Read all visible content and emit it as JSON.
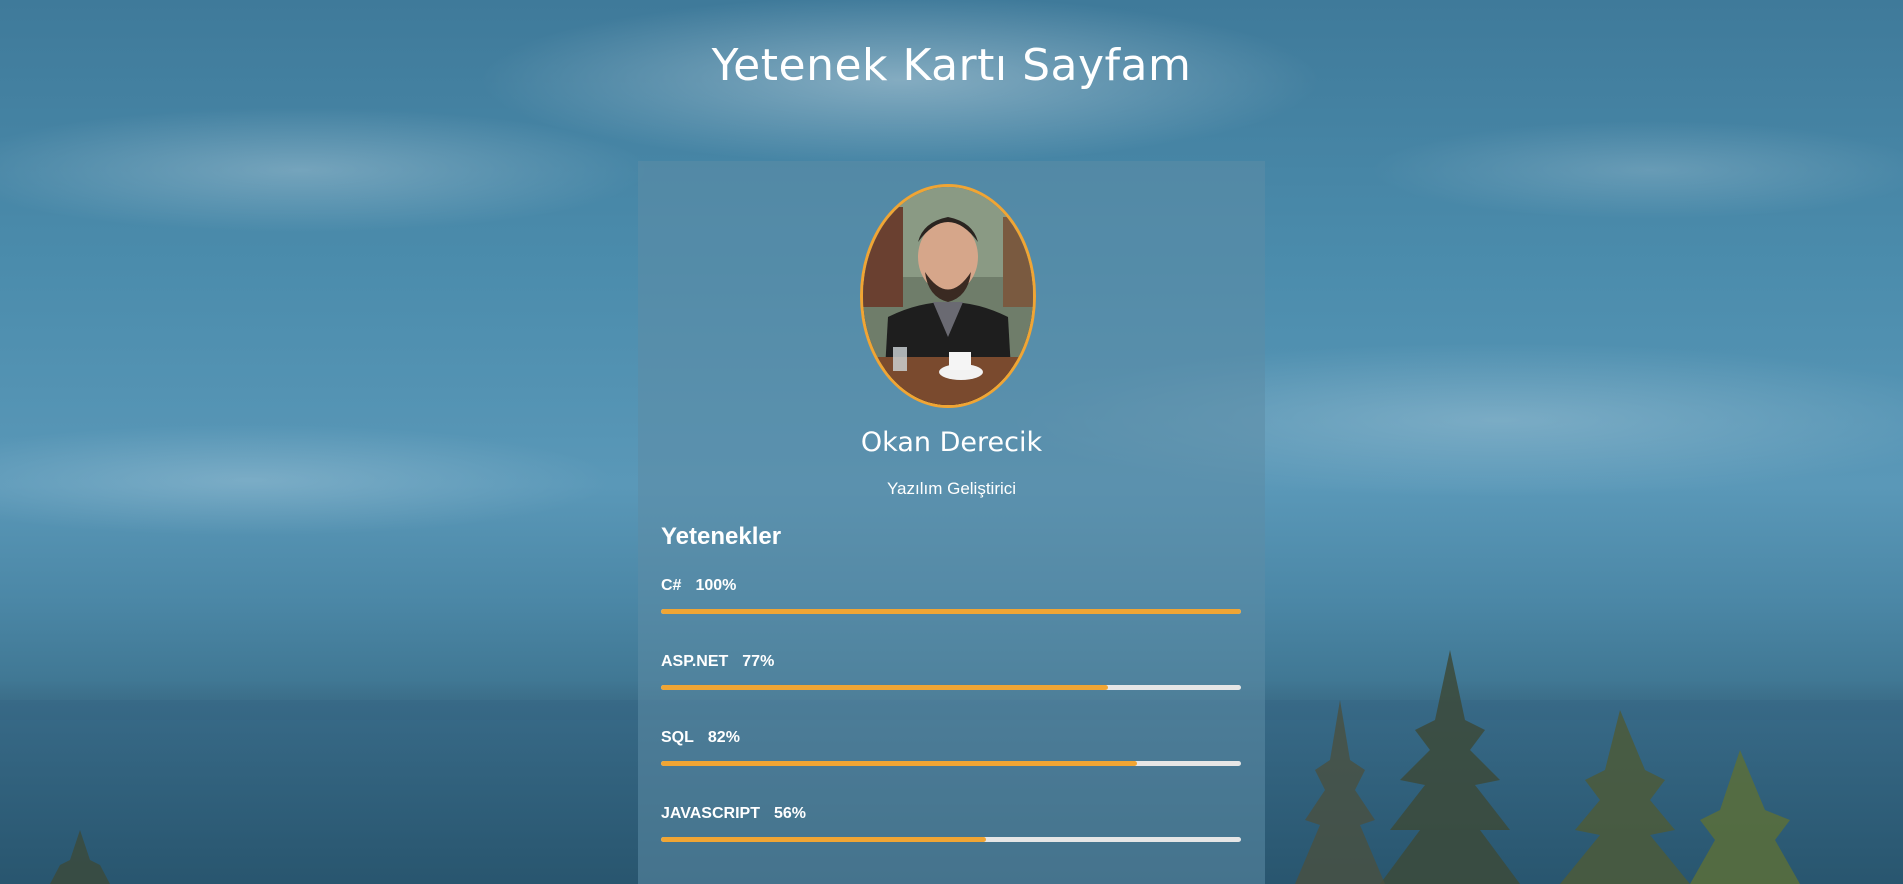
{
  "page": {
    "title": "Yetenek Kartı Sayfam"
  },
  "profile": {
    "name": "Okan Derecik",
    "role": "Yazılım Geliştirici",
    "avatar_border_color": "#f0a534"
  },
  "skills": {
    "heading": "Yetenekler",
    "bar_color": "#f0a534",
    "track_color": "#e6e6e6",
    "items": [
      {
        "label": "C#",
        "percent_text": "100%",
        "percent": 100
      },
      {
        "label": "ASP.NET",
        "percent_text": "77%",
        "percent": 77
      },
      {
        "label": "SQL",
        "percent_text": "82%",
        "percent": 82
      },
      {
        "label": "JAVASCRIPT",
        "percent_text": "56%",
        "percent": 56
      }
    ]
  }
}
